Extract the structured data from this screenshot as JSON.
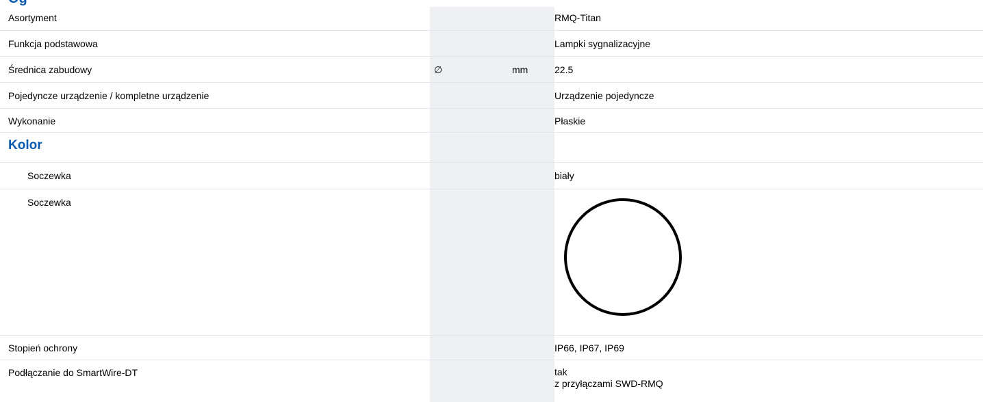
{
  "section_heading_fragment": "Og",
  "colors": {
    "heading": "#0a5bb0",
    "shade": "#eef0f3",
    "rule": "#e3e5e8"
  },
  "rows": [
    {
      "label": "Asortyment",
      "symbol": "",
      "unit": "",
      "value": "RMQ-Titan"
    },
    {
      "label": "Funkcja podstawowa",
      "symbol": "",
      "unit": "",
      "value": "Lampki sygnalizacyjne"
    },
    {
      "label": "Średnica zabudowy",
      "symbol": "∅",
      "unit": "mm",
      "value": "22.5"
    },
    {
      "label": "Pojedyncze urządzenie / kompletne urządzenie",
      "symbol": "",
      "unit": "",
      "value": "Urządzenie pojedyncze"
    },
    {
      "label": "Wykonanie",
      "symbol": "",
      "unit": "",
      "value": "Płaskie"
    }
  ],
  "kolor_heading": "Kolor",
  "kolor_rows": [
    {
      "label": "Soczewka",
      "value": "biały"
    },
    {
      "label": "Soczewka",
      "value_icon": "white-lens-circle-icon"
    }
  ],
  "rows_after": [
    {
      "label": "Stopień ochrony",
      "value": "IP66, IP67, IP69"
    },
    {
      "label": "Podłączanie do SmartWire-DT",
      "value_line1": "tak",
      "value_line2": "z przyłączami SWD-RMQ"
    }
  ]
}
